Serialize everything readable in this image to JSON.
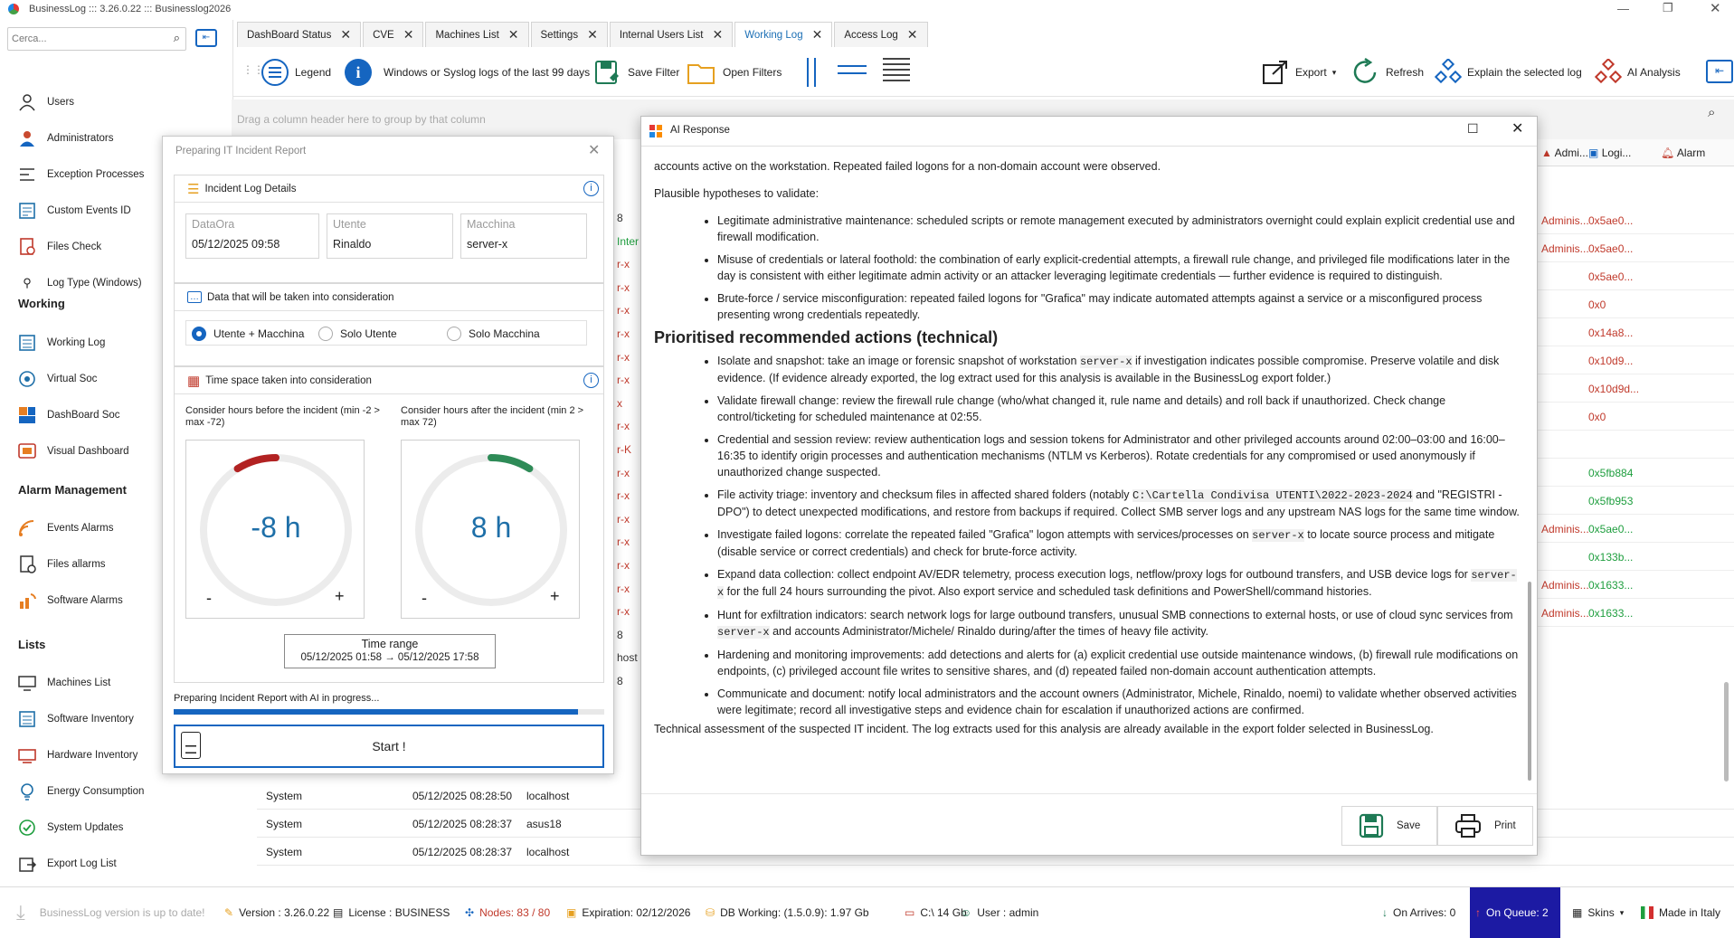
{
  "app": {
    "title": "BusinessLog ::: 3.26.0.22 ::: Businesslog2026"
  },
  "search": {
    "placeholder": "Cerca..."
  },
  "sidebar": {
    "items_top": [
      "Users",
      "Administrators",
      "Exception Processes",
      "Custom Events ID",
      "Files Check",
      "Log Type (Windows)"
    ],
    "section_working": "Working",
    "items_working": [
      "Working Log",
      "Virtual Soc",
      "DashBoard Soc",
      "Visual Dashboard"
    ],
    "section_alarm": "Alarm Management",
    "items_alarm": [
      "Events Alarms",
      "Files allarms",
      "Software Alarms"
    ],
    "section_lists": "Lists",
    "items_lists": [
      "Machines List",
      "Software Inventory",
      "Hardware Inventory",
      "Energy Consumption",
      "System Updates",
      "Export Log List"
    ]
  },
  "tabs": [
    "DashBoard Status",
    "CVE",
    "Machines List",
    "Settings",
    "Internal Users List",
    "Working Log",
    "Access Log"
  ],
  "toolbar": {
    "legend": "Legend",
    "info": "Windows or Syslog logs of the last 99 days",
    "save_filter": "Save Filter",
    "open_filters": "Open Filters",
    "export": "Export",
    "refresh": "Refresh",
    "explain": "Explain the selected log",
    "ai_analysis": "AI Analysis"
  },
  "groupbar": {
    "hint": "Drag a column header here to group by that column"
  },
  "grid": {
    "col_admin": "Admi...",
    "col_login": "Logi...",
    "col_alarm": "Alarm",
    "right_rows": [
      {
        "admin": "Adminis...",
        "login": "0x5ae0..."
      },
      {
        "admin": "Adminis...",
        "login": "0x5ae0..."
      },
      {
        "admin": "",
        "login": "0x5ae0..."
      },
      {
        "admin": "",
        "login": "0x0"
      },
      {
        "admin": "",
        "login": "0x14a8..."
      },
      {
        "admin": "",
        "login": "0x10d9..."
      },
      {
        "admin": "",
        "login": "0x10d9d..."
      },
      {
        "admin": "",
        "login": "0x0"
      },
      {
        "admin": "",
        "login": ""
      },
      {
        "admin": "",
        "login": "0x5fb884"
      },
      {
        "admin": "",
        "login": "0x5fb953"
      },
      {
        "admin": "Adminis...",
        "login": "0x5ae0..."
      },
      {
        "admin": "",
        "login": "0x133b..."
      },
      {
        "admin": "Adminis...",
        "login": "0x1633..."
      },
      {
        "admin": "Adminis...",
        "login": "0x1633..."
      }
    ],
    "left_frag": [
      "8",
      "Inter",
      "r-x",
      "r-x",
      "r-x",
      "r-x",
      "r-x",
      "r-x",
      "x",
      "r-x",
      "r-K",
      "r-x",
      "r-x",
      "r-x",
      "r-x",
      "r-x",
      "r-x",
      "r-x",
      "8",
      "host",
      "8"
    ],
    "bottom_rows": [
      {
        "level": "System",
        "date": "05/12/2025 08:28:50",
        "host": "localhost"
      },
      {
        "level": "System",
        "date": "05/12/2025 08:28:37",
        "host": "asus18"
      },
      {
        "level": "System",
        "date": "05/12/2025 08:28:37",
        "host": "localhost"
      }
    ]
  },
  "incident": {
    "title": "Preparing IT Incident Report",
    "details_header": "Incident Log Details",
    "f_date_label": "DataOra",
    "f_date_value": "05/12/2025 09:58",
    "f_user_label": "Utente",
    "f_user_value": "Rinaldo",
    "f_machine_label": "Macchina",
    "f_machine_value": "server-x",
    "data_header": "Data that will be taken into consideration",
    "radio": [
      "Utente + Macchina",
      "Solo Utente",
      "Solo Macchina"
    ],
    "selected_radio": 0,
    "time_header": "Time space taken into consideration",
    "before_label": "Consider hours before the incident (min -2 > max -72)",
    "after_label": "Consider hours after the incident (min 2 > max 72)",
    "before_value": -8,
    "after_value": 8,
    "before_text": "-8 h",
    "after_text": "8 h",
    "minus": "-",
    "plus": "+",
    "range_title": "Time range",
    "range_value": "05/12/2025 01:58 → 05/12/2025 17:58",
    "progress_text": "Preparing Incident Report with AI in progress...",
    "progress": 0.94,
    "start": "Start !"
  },
  "ai": {
    "title": "AI Response",
    "intro": "accounts active on the workstation. Repeated failed logons for a non-domain account were observed.",
    "hyp_title": "Plausible hypotheses to validate:",
    "hyp": [
      "Legitimate administrative maintenance: scheduled scripts or remote management executed by administrators overnight could explain explicit credential use and firewall modification.",
      "Misuse of credentials or lateral foothold: the combination of early explicit-credential attempts, a firewall rule change, and privileged file modifications later in the day is consistent with either legitimate admin activity or an attacker leveraging legitimate credentials — further evidence is required to distinguish.",
      "Brute-force / service misconfiguration: repeated failed logons for \"Grafica\" may indicate automated attempts against a service or a misconfigured process presenting wrong credentials repeatedly."
    ],
    "actions_title": "Prioritised recommended actions (technical)",
    "actions": [
      [
        "Isolate and snapshot: take an image or forensic snapshot of workstation ",
        "server-x",
        " if investigation indicates possible compromise. Preserve volatile and disk evidence. (If evidence already exported, the log extract used for this analysis is available in the BusinessLog export folder.)"
      ],
      [
        "Validate firewall change: review the firewall rule change (who/what changed it, rule name and details) and roll back if unauthorized. Check change control/ticketing for scheduled maintenance at 02:55.",
        "",
        ""
      ],
      [
        "Credential and session review: review authentication logs and session tokens for Administrator and other privileged accounts around 02:00–03:00 and 16:00–16:35 to identify origin processes and authentication mechanisms (NTLM vs Kerberos). Rotate credentials for any compromised or used anonymously if unauthorized change suspected.",
        "",
        ""
      ],
      [
        "File activity triage: inventory and checksum files in affected shared folders (notably ",
        "C:\\Cartella Condivisa UTENTI\\2022-2023-2024",
        " and \"REGISTRI - DPO\") to detect unexpected modifications, and restore from backups if required. Collect SMB server logs and any upstream NAS logs for the same time window."
      ],
      [
        "Investigate failed logons: correlate the repeated failed \"Grafica\" logon attempts with services/processes on ",
        "server-x",
        " to locate source process and mitigate (disable service or correct credentials) and check for brute-force activity."
      ],
      [
        "Expand data collection: collect endpoint AV/EDR telemetry, process execution logs, netflow/proxy logs for outbound transfers, and USB device logs for ",
        "server-x",
        " for the full 24 hours surrounding the pivot. Also export service and scheduled task definitions and PowerShell/command histories."
      ],
      [
        "Hunt for exfiltration indicators: search network logs for large outbound transfers, unusual SMB connections to external hosts, or use of cloud sync services from ",
        "server-x",
        " and accounts Administrator/Michele/ Rinaldo during/after the times of heavy file activity."
      ],
      [
        "Hardening and monitoring improvements: add detections and alerts for (a) explicit credential use outside maintenance windows, (b) firewall rule modifications on endpoints, (c) privileged account file writes to sensitive shares, and (d) repeated failed non-domain account authentication attempts.",
        "",
        ""
      ],
      [
        "Communicate and document: notify local administrators and the account owners (Administrator, Michele, Rinaldo, noemi) to validate whether observed activities were legitimate; record all investigative steps and evidence chain for escalation if unauthorized actions are confirmed.",
        "",
        ""
      ]
    ],
    "footer_text": "Technical assessment of the suspected IT incident. The log extracts used for this analysis are already available in the export folder selected in BusinessLog.",
    "save": "Save",
    "print": "Print"
  },
  "status": {
    "update": "BusinessLog version is up to date!",
    "version": "Version : 3.26.0.22",
    "license": "License : BUSINESS",
    "nodes": "Nodes: 83 / 80",
    "expiration": "Expiration: 02/12/2026",
    "db": "DB Working: (1.5.0.9): 1.97 Gb",
    "disk": "C:\\ 14 Gb",
    "user": "User : admin",
    "arrives": "On Arrives: 0",
    "queue": "On Queue: 2",
    "skins": "Skins",
    "made": "Made in Italy"
  },
  "colors": {
    "accent": "#1565c0",
    "danger": "#c0392b",
    "queue_bg": "#1c1aa3",
    "dark_red": "#a61b1b",
    "green": "#1e9e3e"
  }
}
